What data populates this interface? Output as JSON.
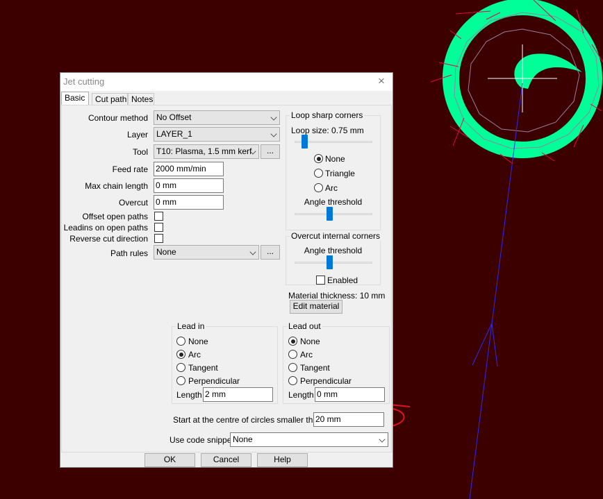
{
  "colors": {
    "background": "#3d0000",
    "shape_fill": "#00ff99",
    "path_blue": "#2a2aff",
    "lead_magenta": "#e8004f",
    "annotation_red": "#e0141c",
    "slider_accent": "#0078d7"
  },
  "dialog": {
    "title": "Jet cutting",
    "close_icon": "×",
    "tabs": [
      "Basic",
      "Cut path",
      "Notes"
    ],
    "active_tab": "Basic"
  },
  "form": {
    "contour_method": {
      "label": "Contour method",
      "value": "No Offset"
    },
    "layer": {
      "label": "Layer",
      "value": "LAYER_1"
    },
    "tool": {
      "label": "Tool",
      "value": "T10: Plasma, 1.5 mm kerf",
      "browse": "..."
    },
    "feed_rate": {
      "label": "Feed rate",
      "value": "2000 mm/min"
    },
    "max_chain_length": {
      "label": "Max chain length",
      "value": "0 mm"
    },
    "overcut": {
      "label": "Overcut",
      "value": "0 mm"
    },
    "offset_open_paths": {
      "label": "Offset open paths",
      "checked": false
    },
    "leadins_on_open_paths": {
      "label": "Leadins on open paths",
      "checked": false
    },
    "reverse_cut_direction": {
      "label": "Reverse cut direction",
      "checked": false
    },
    "path_rules": {
      "label": "Path rules",
      "value": "None",
      "browse": "..."
    }
  },
  "loop_sharp_corners": {
    "title": "Loop sharp corners",
    "loop_size": "Loop size: 0.75 mm",
    "options": [
      "None",
      "Triangle",
      "Arc"
    ],
    "selected": "None",
    "angle_threshold_label": "Angle threshold",
    "loop_size_level": 0.1,
    "angle_level": 0.45
  },
  "overcut_internal_corners": {
    "title": "Overcut internal corners",
    "angle_threshold_label": "Angle threshold",
    "angle_level": 0.45,
    "enabled_label": "Enabled",
    "enabled": false
  },
  "material": {
    "thickness": "Material thickness: 10 mm",
    "edit_button": "Edit material"
  },
  "lead_in": {
    "title": "Lead in",
    "options": [
      "None",
      "Arc",
      "Tangent",
      "Perpendicular"
    ],
    "selected": "Arc",
    "length_label": "Length",
    "length_value": "2 mm"
  },
  "lead_out": {
    "title": "Lead out",
    "options": [
      "None",
      "Arc",
      "Tangent",
      "Perpendicular"
    ],
    "selected": "None",
    "length_label": "Length",
    "length_value": "0 mm"
  },
  "centre_circles": {
    "label": "Start at the centre of circles smaller than",
    "value": "20 mm"
  },
  "code_snippet": {
    "label": "Use code snippet",
    "value": "None"
  },
  "buttons": {
    "ok": "OK",
    "cancel": "Cancel",
    "help": "Help"
  }
}
